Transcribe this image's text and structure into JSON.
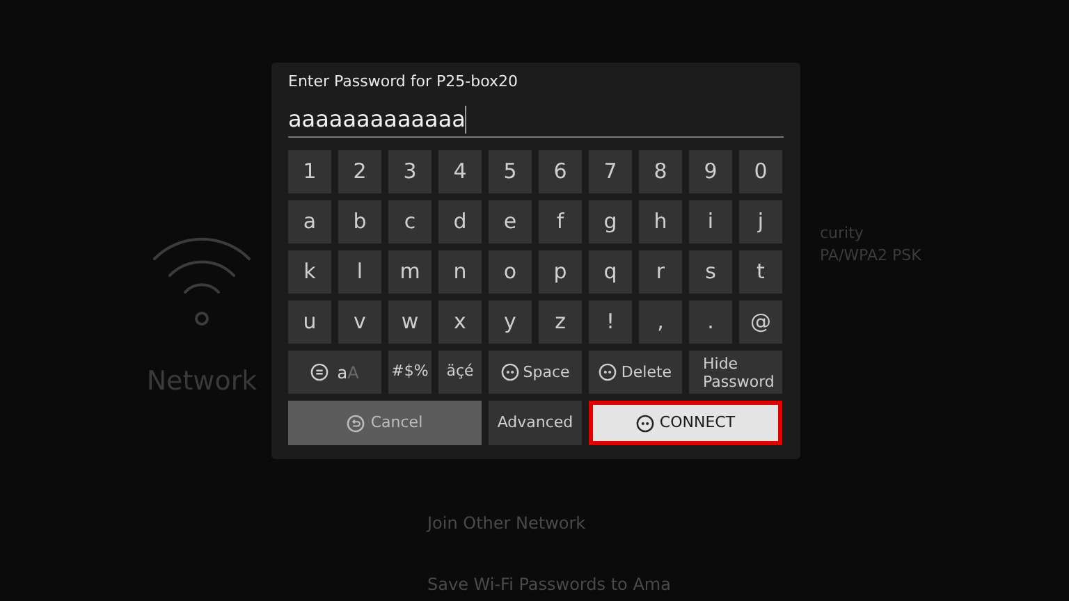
{
  "background": {
    "section_title": "Network",
    "security_label": "curity",
    "security_value": "PA/WPA2 PSK",
    "menu_items": [
      "Join Other Network",
      "Save Wi-Fi Passwords to Ama"
    ]
  },
  "dialog": {
    "title": "Enter Password for P25-box20",
    "password": {
      "value": "aaaaaaaaaaaaa"
    },
    "key_rows": [
      [
        {
          "label": "1"
        },
        {
          "label": "2"
        },
        {
          "label": "3"
        },
        {
          "label": "4"
        },
        {
          "label": "5"
        },
        {
          "label": "6"
        },
        {
          "label": "7"
        },
        {
          "label": "8"
        },
        {
          "label": "9"
        },
        {
          "label": "0"
        }
      ],
      [
        {
          "label": "a"
        },
        {
          "label": "b"
        },
        {
          "label": "c"
        },
        {
          "label": "d"
        },
        {
          "label": "e"
        },
        {
          "label": "f"
        },
        {
          "label": "g"
        },
        {
          "label": "h"
        },
        {
          "label": "i"
        },
        {
          "label": "j"
        }
      ],
      [
        {
          "label": "k"
        },
        {
          "label": "l"
        },
        {
          "label": "m"
        },
        {
          "label": "n"
        },
        {
          "label": "o"
        },
        {
          "label": "p"
        },
        {
          "label": "q"
        },
        {
          "label": "r"
        },
        {
          "label": "s"
        },
        {
          "label": "t"
        }
      ],
      [
        {
          "label": "u"
        },
        {
          "label": "v"
        },
        {
          "label": "w"
        },
        {
          "label": "x"
        },
        {
          "label": "y"
        },
        {
          "label": "z"
        },
        {
          "label": "!"
        },
        {
          "label": ","
        },
        {
          "label": "."
        },
        {
          "label": "@"
        }
      ]
    ],
    "function_keys": [
      {
        "kind": "case",
        "parts": [
          {
            "text": "a",
            "active": true
          },
          {
            "text": "A",
            "active": false
          }
        ]
      },
      {
        "kind": "text",
        "label": "#$%"
      },
      {
        "kind": "text",
        "label": "äçé"
      },
      {
        "kind": "remote",
        "label": "Space"
      },
      {
        "kind": "remote",
        "label": "Delete"
      },
      {
        "kind": "wide",
        "label": "Hide Password"
      }
    ],
    "actions": [
      {
        "kind": "cancel",
        "label": "Cancel",
        "selected": false
      },
      {
        "kind": "plain",
        "label": "Advanced",
        "selected": false
      },
      {
        "kind": "primary",
        "label": "CONNECT",
        "selected": true
      }
    ]
  }
}
